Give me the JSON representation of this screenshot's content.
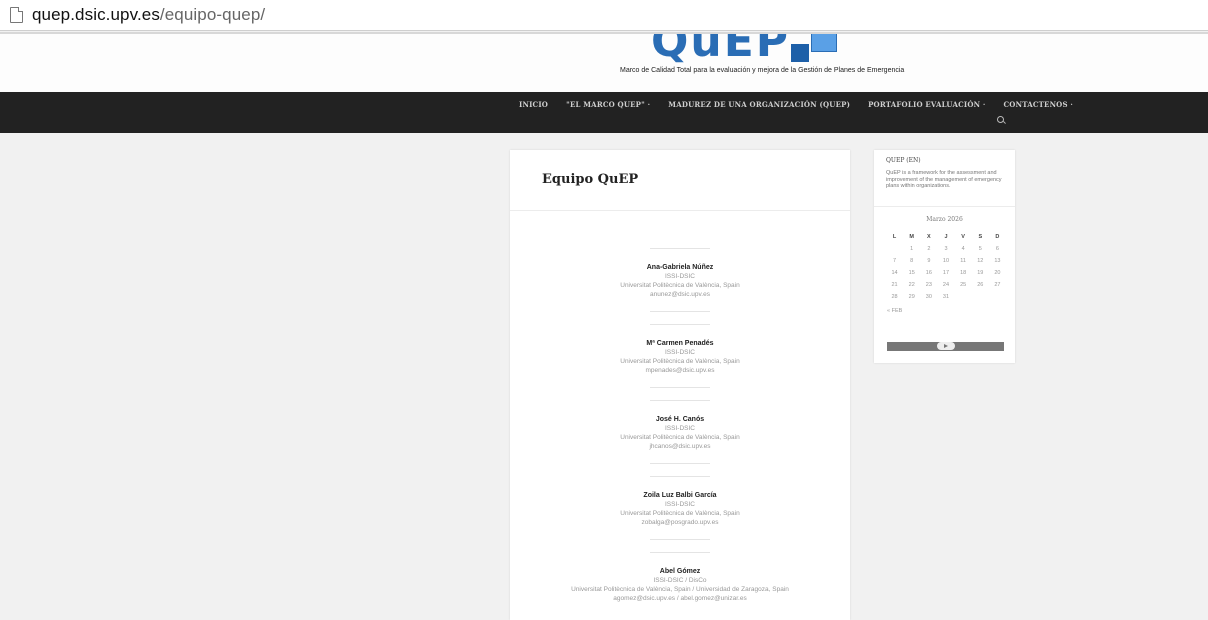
{
  "browser": {
    "url_host": "quep.dsic.upv.es",
    "url_path": "/equipo-quep/"
  },
  "header": {
    "logo_text": "QuEP",
    "tagline": "Marco de Calidad Total para la evaluación y mejora de la Gestión de Planes de Emergencia"
  },
  "nav": {
    "items": [
      {
        "label": "INICIO"
      },
      {
        "label": "\"EL MARCO QUEP\" ·"
      },
      {
        "label": "MADUREZ DE UNA ORGANIZACIÓN (QUEP)"
      },
      {
        "label": "PORTAFOLIO EVALUACIÓN ·"
      },
      {
        "label": "CONTACTENOS ·"
      }
    ]
  },
  "page": {
    "title": "Equipo QuEP",
    "members": [
      {
        "name": "Ana-Gabriela Núñez",
        "dept": "ISSI-DSIC",
        "org": "Universitat Politècnica de València, Spain",
        "email": "anunez@dsic.upv.es"
      },
      {
        "name": "Mª Carmen Penadés",
        "dept": "ISSI-DSIC",
        "org": "Universitat Politècnica de València, Spain",
        "email": "mpenades@dsic.upv.es"
      },
      {
        "name": "José H. Canós",
        "dept": "ISSI-DSIC",
        "org": "Universitat Politècnica de València, Spain",
        "email": "jhcanos@dsic.upv.es"
      },
      {
        "name": "Zoila Luz Balbi García",
        "dept": "ISSI-DSIC",
        "org": "Universitat Politècnica de València, Spain",
        "email": "zobalga@posgrado.upv.es"
      },
      {
        "name": "Abel Gómez",
        "dept": "ISSI-DSIC / DisCo",
        "org": "Universitat Politècnica de València, Spain / Universidad de Zaragoza, Spain",
        "email": "agomez@dsic.upv.es / abel.gomez@unizar.es"
      }
    ]
  },
  "sidebar": {
    "widget_title": "QUEP (EN)",
    "widget_text": "QuEP is a framework for the assessment and improvement of the management of emergency plans within organizations.",
    "calendar": {
      "caption": "Marzo 2026",
      "headers": [
        "L",
        "M",
        "X",
        "J",
        "V",
        "S",
        "D"
      ],
      "rows": [
        [
          "",
          "1",
          "2",
          "3",
          "4",
          "5",
          "6"
        ],
        [
          "7",
          "8",
          "9",
          "10",
          "11",
          "12",
          "13"
        ],
        [
          "14",
          "15",
          "16",
          "17",
          "18",
          "19",
          "20"
        ],
        [
          "21",
          "22",
          "23",
          "24",
          "25",
          "26",
          "27"
        ],
        [
          "28",
          "29",
          "30",
          "31",
          "",
          "",
          ""
        ]
      ],
      "prev_link": "« FEB"
    }
  }
}
